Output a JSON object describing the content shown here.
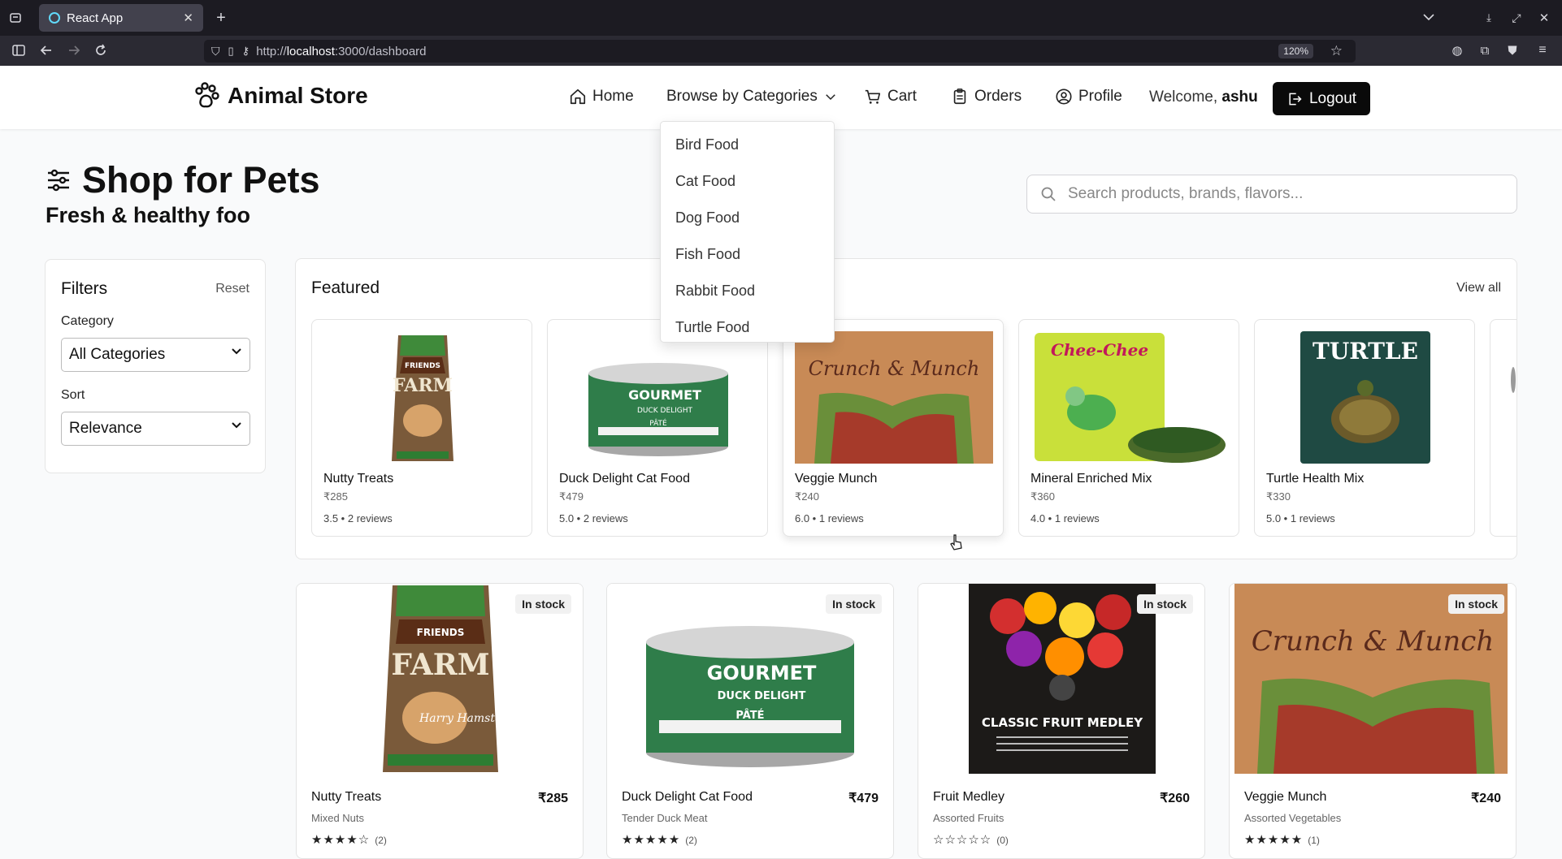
{
  "browser": {
    "tab_title": "React App",
    "url_prefix": "http://",
    "url_host": "localhost",
    "url_path": ":3000/dashboard",
    "zoom": "120%"
  },
  "nav": {
    "brand": "Animal Store",
    "home": "Home",
    "categories": "Browse by Categories",
    "cart": "Cart",
    "orders": "Orders",
    "profile": "Profile",
    "welcome_prefix": "Welcome,",
    "username": "ashu",
    "logout": "Logout"
  },
  "dropdown": {
    "items": [
      "Bird Food",
      "Cat Food",
      "Dog Food",
      "Fish Food",
      "Rabbit Food",
      "Turtle Food"
    ]
  },
  "page": {
    "title": "Shop for Pets",
    "subtitle": "Fresh & healthy foo",
    "search_placeholder": "Search products, brands, flavors..."
  },
  "filters": {
    "title": "Filters",
    "reset": "Reset",
    "category_label": "Category",
    "category_value": "All Categories",
    "sort_label": "Sort",
    "sort_value": "Relevance"
  },
  "featured": {
    "title": "Featured",
    "view_all": "View all",
    "items": [
      {
        "name": "Nutty Treats",
        "price": "₹285",
        "rating": "3.5 • 2 reviews"
      },
      {
        "name": "Duck Delight Cat Food",
        "price": "₹479",
        "rating": "5.0 • 2 reviews"
      },
      {
        "name": "Veggie Munch",
        "price": "₹240",
        "rating": "6.0 • 1 reviews"
      },
      {
        "name": "Mineral Enriched Mix",
        "price": "₹360",
        "rating": "4.0 • 1 reviews"
      },
      {
        "name": "Turtle Health Mix",
        "price": "₹330",
        "rating": "5.0 • 1 reviews"
      }
    ]
  },
  "products": [
    {
      "badge": "In stock",
      "name": "Nutty Treats",
      "price": "₹285",
      "sub": "Mixed Nuts",
      "stars": "★★★★☆",
      "count": "(2)"
    },
    {
      "badge": "In stock",
      "name": "Duck Delight Cat Food",
      "price": "₹479",
      "sub": "Tender Duck Meat",
      "stars": "★★★★★",
      "count": "(2)"
    },
    {
      "badge": "In stock",
      "name": "Fruit Medley",
      "price": "₹260",
      "sub": "Assorted Fruits",
      "stars": "☆☆☆☆☆",
      "count": "(0)"
    },
    {
      "badge": "In stock",
      "name": "Veggie Munch",
      "price": "₹240",
      "sub": "Assorted Vegetables",
      "stars": "★★★★★",
      "count": "(1)"
    }
  ],
  "artwork": {
    "farm_brand": "FRIENDS",
    "farm_word": "FARM",
    "farm_sub": "Harry Hamster",
    "gourmet": "GOURMET",
    "duck": "DUCK DELIGHT",
    "pate": "PÂTÉ",
    "munch": "Crunch & Munch",
    "chee": "Chee-Chee",
    "turtle": "TURTLE",
    "fruit": "CLASSIC FRUIT MEDLEY"
  },
  "colors": {
    "accent": "#0a0a0a",
    "page_bg": "#f9fafb",
    "browser_bg": "#1c1b22"
  }
}
